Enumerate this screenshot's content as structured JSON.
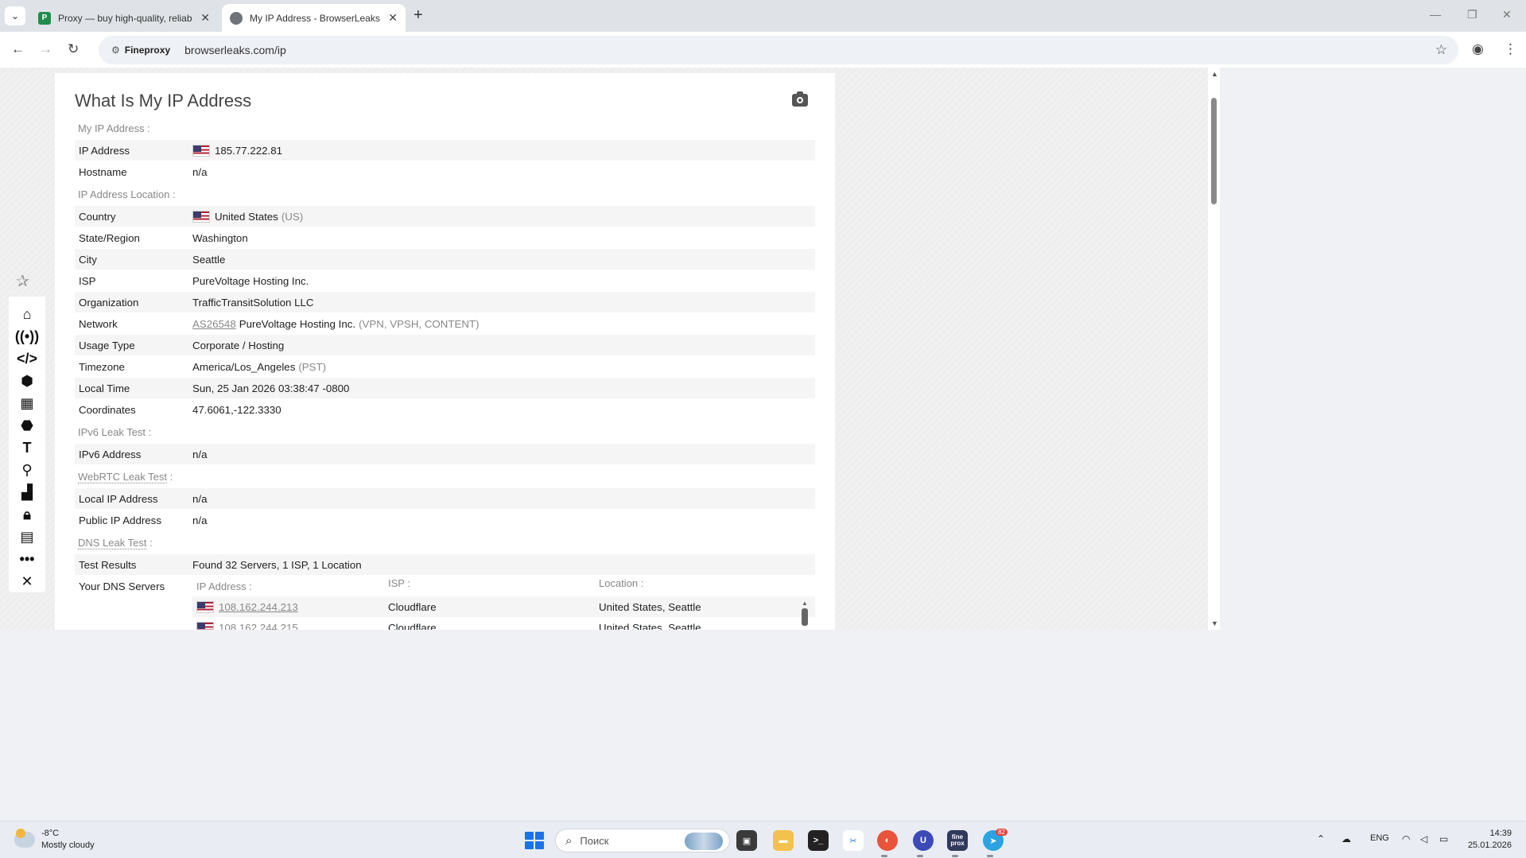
{
  "browser": {
    "tabs": [
      {
        "title": "Proxy — buy high-quality, reliab",
        "favicon": "P",
        "active": false
      },
      {
        "title": "My IP Address - BrowserLeaks",
        "active": true
      }
    ],
    "site_chip": "Fineproxy",
    "url": "browserleaks.com/ip"
  },
  "page": {
    "title": "What Is My IP Address",
    "sections": {
      "my_ip": "My IP Address :",
      "location": "IP Address Location :",
      "ipv6": "IPv6 Leak Test :",
      "webrtc_link": "WebRTC Leak Test",
      "dns_link": "DNS Leak Test",
      "colon": " :"
    },
    "rows": {
      "ip": {
        "key": "IP Address",
        "value": "185.77.222.81"
      },
      "hostname": {
        "key": "Hostname",
        "value": "n/a"
      },
      "country": {
        "key": "Country",
        "value": "United States",
        "extra": "(US)"
      },
      "state": {
        "key": "State/Region",
        "value": "Washington"
      },
      "city": {
        "key": "City",
        "value": "Seattle"
      },
      "isp": {
        "key": "ISP",
        "value": "PureVoltage Hosting Inc."
      },
      "org": {
        "key": "Organization",
        "value": "TrafficTransitSolution LLC"
      },
      "network": {
        "key": "Network",
        "link": "AS26548",
        "value": "PureVoltage Hosting Inc.",
        "extra": "(VPN, VPSH, CONTENT)"
      },
      "usage": {
        "key": "Usage Type",
        "value": "Corporate / Hosting"
      },
      "timezone": {
        "key": "Timezone",
        "value": "America/Los_Angeles",
        "extra": "(PST)"
      },
      "local_time": {
        "key": "Local Time",
        "value": "Sun, 25 Jan 2026 03:38:47 -0800"
      },
      "coords": {
        "key": "Coordinates",
        "value": "47.6061,-122.3330"
      },
      "ipv6_addr": {
        "key": "IPv6 Address",
        "value": "n/a"
      },
      "local_ip": {
        "key": "Local IP Address",
        "value": "n/a"
      },
      "public_ip": {
        "key": "Public IP Address",
        "value": "n/a"
      },
      "test_results": {
        "key": "Test Results",
        "value": "Found 32 Servers, 1 ISP, 1 Location"
      },
      "dns_servers": {
        "key": "Your DNS Servers"
      }
    },
    "dns_table": {
      "headers": [
        "IP Address :",
        "ISP :",
        "Location :"
      ],
      "rows": [
        {
          "ip": "108.162.244.213",
          "isp": "Cloudflare",
          "location": "United States, Seattle"
        },
        {
          "ip": "108.162.244.215",
          "isp": "Cloudflare",
          "location": "United States, Seattle"
        }
      ]
    }
  },
  "taskbar": {
    "temp": "-8°C",
    "weather": "Mostly cloudy",
    "search_placeholder": "Поиск",
    "lang": "ENG",
    "time": "14:39",
    "date": "25.01.2026",
    "telegram_badge": "82",
    "fineproxy_app": "fine prox"
  },
  "colors": {
    "accent": "#1a73e8",
    "link_muted": "#888888",
    "row_shade": "#f5f5f5"
  }
}
